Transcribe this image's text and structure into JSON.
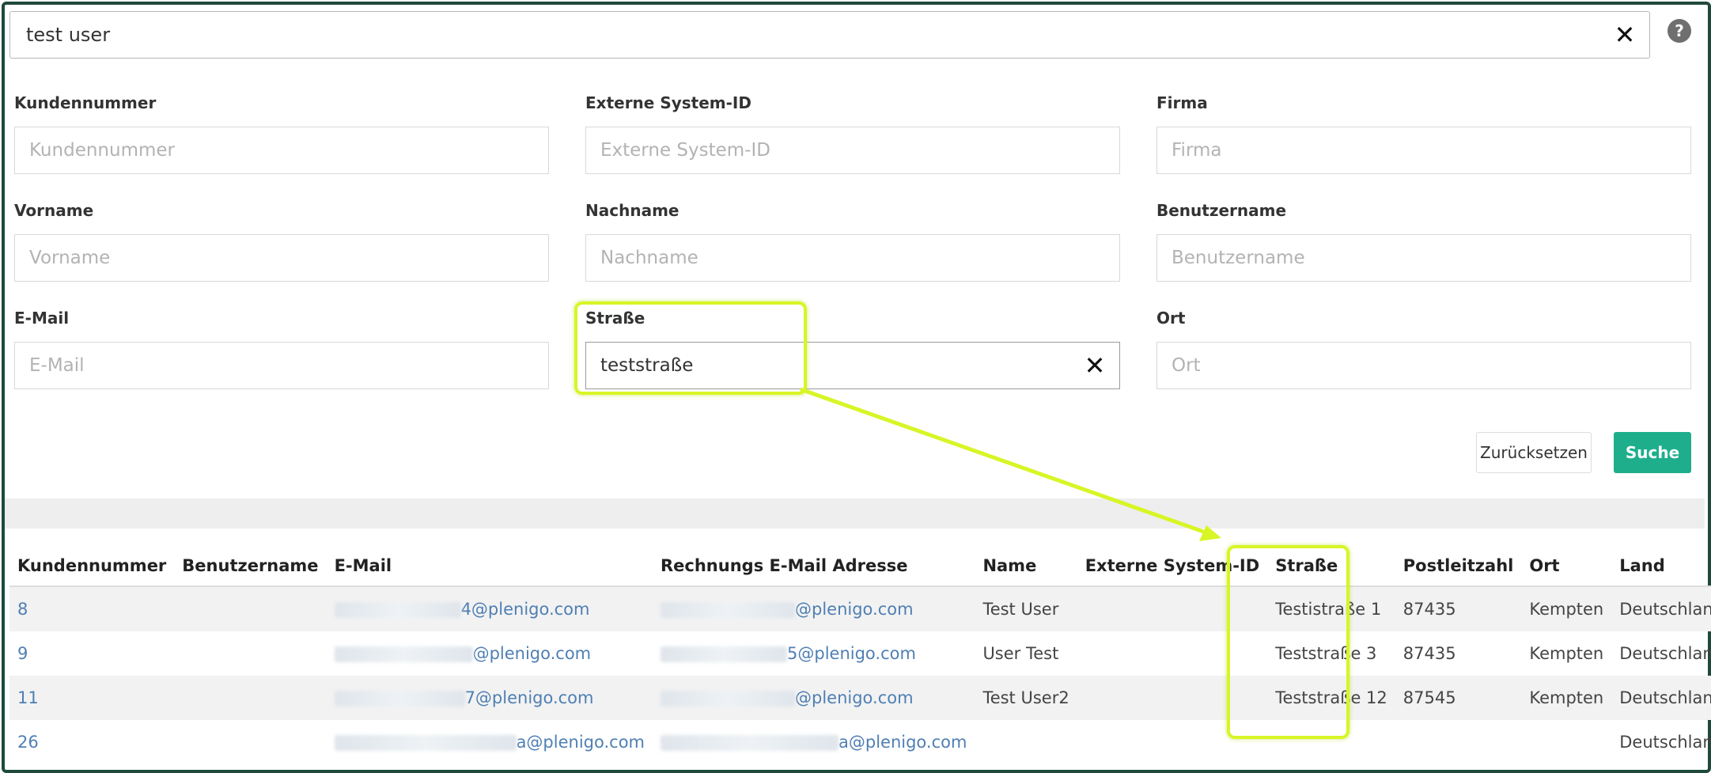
{
  "search": {
    "value": "test user",
    "clear_icon": "close-icon"
  },
  "help_icon": "?",
  "fields": {
    "kundennummer": {
      "label": "Kundennummer",
      "placeholder": "Kundennummer",
      "value": ""
    },
    "externe_id": {
      "label": "Externe System-ID",
      "placeholder": "Externe System-ID",
      "value": ""
    },
    "firma": {
      "label": "Firma",
      "placeholder": "Firma",
      "value": ""
    },
    "vorname": {
      "label": "Vorname",
      "placeholder": "Vorname",
      "value": ""
    },
    "nachname": {
      "label": "Nachname",
      "placeholder": "Nachname",
      "value": ""
    },
    "benutzername": {
      "label": "Benutzername",
      "placeholder": "Benutzername",
      "value": ""
    },
    "email": {
      "label": "E-Mail",
      "placeholder": "E-Mail",
      "value": ""
    },
    "strasse": {
      "label": "Straße",
      "placeholder": "Straße",
      "value": "teststraße"
    },
    "ort": {
      "label": "Ort",
      "placeholder": "Ort",
      "value": ""
    }
  },
  "buttons": {
    "reset": "Zurücksetzen",
    "search": "Suche"
  },
  "colors": {
    "accent": "#1fae8c",
    "highlight": "#d8f526",
    "link": "#4f7fb3"
  },
  "table": {
    "headers": [
      "Kundennummer",
      "Benutzername",
      "E-Mail",
      "Rechnungs E-Mail Adresse",
      "Name",
      "Externe System-ID",
      "Straße",
      "Postleitzahl",
      "Ort",
      "Land"
    ],
    "rows": [
      {
        "id": "8",
        "username": "",
        "email_visible": "4@plenigo.com",
        "billing_visible": "@plenigo.com",
        "name": "Test User",
        "ext": "",
        "street": "Testistraße 1",
        "zip": "87435",
        "city": "Kempten",
        "country": "Deutschland"
      },
      {
        "id": "9",
        "username": "",
        "email_visible": "@plenigo.com",
        "billing_visible": "5@plenigo.com",
        "name": "User Test",
        "ext": "",
        "street": "Teststraße 3",
        "zip": "87435",
        "city": "Kempten",
        "country": "Deutschland"
      },
      {
        "id": "11",
        "username": "",
        "email_visible": "7@plenigo.com",
        "billing_visible": "@plenigo.com",
        "name": "Test User2",
        "ext": "",
        "street": "Teststraße 12",
        "zip": "87545",
        "city": "Kempten",
        "country": "Deutschland"
      },
      {
        "id": "26",
        "username": "",
        "email_visible": "a@plenigo.com",
        "billing_visible": "a@plenigo.com",
        "name": "",
        "ext": "",
        "street": "",
        "zip": "",
        "city": "",
        "country": "Deutschland"
      }
    ]
  }
}
